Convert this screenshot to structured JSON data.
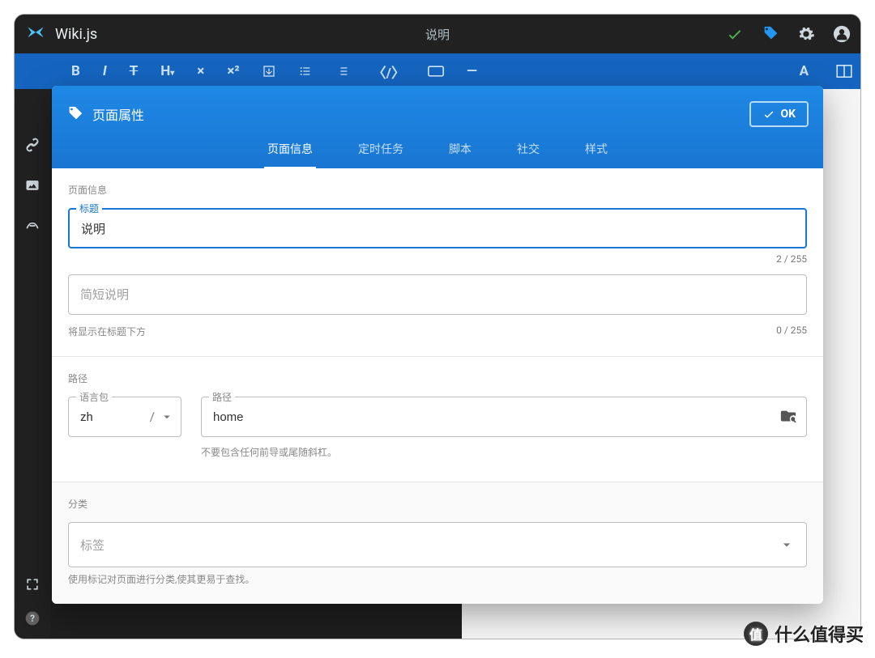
{
  "app": {
    "name": "Wiki.js",
    "page_title": "说明"
  },
  "toolbar": {
    "buttons": [
      "B",
      "I",
      "T",
      "H▾",
      "×",
      "×²",
      "☐",
      "≔",
      "≔",
      "〈/〉",
      "⊞",
      "—"
    ]
  },
  "dialog": {
    "title": "页面属性",
    "ok_label": "OK",
    "tabs": {
      "info": "页面信息",
      "schedule": "定时任务",
      "script": "脚本",
      "social": "社交",
      "style": "样式"
    },
    "info_section": {
      "heading": "页面信息",
      "title_label": "标题",
      "title_value": "说明",
      "title_counter": "2 / 255",
      "short_desc_placeholder": "简短说明",
      "short_desc_hint": "将显示在标题下方",
      "short_desc_counter": "0 / 255"
    },
    "path_section": {
      "heading": "路径",
      "lang_label": "语言包",
      "lang_value": "zh",
      "lang_sep": "/",
      "path_label": "路径",
      "path_value": "home",
      "path_hint": "不要包含任何前导或尾随斜杠。"
    },
    "cat_section": {
      "heading": "分类",
      "tags_placeholder": "标签",
      "tags_hint": "使用标记对页面进行分类,使其更易于查找。"
    }
  },
  "watermark": "什么值得买"
}
